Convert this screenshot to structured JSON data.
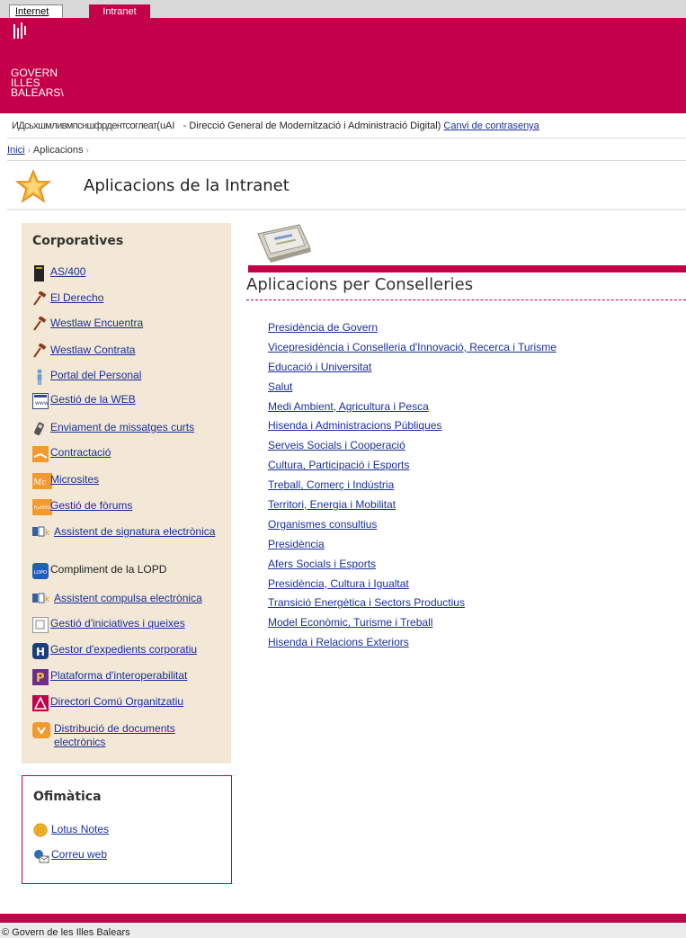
{
  "tabs": {
    "internet": "Internet",
    "intranet": "Intranet"
  },
  "header": {
    "logo_lines": [
      "GOVERN",
      "ILLES",
      "BALEARS\\"
    ]
  },
  "userbar": {
    "scribble": "ИДсьхшмливмпсншфрдентсоглеат",
    "text": "(uAI   - Direcció General de Modernització i Administració Digital)",
    "link": "Canvi de contrasenya"
  },
  "breadcrumb": {
    "home": "Inici",
    "current": "Aplicacions",
    "sep": "›"
  },
  "page_title": "Aplicacions de la Intranet",
  "sidebar": {
    "title": "Corporatives",
    "items": [
      {
        "label": "AS/400",
        "icon": "server-icon",
        "link": true
      },
      {
        "label": "El Derecho",
        "icon": "gavel-icon",
        "link": true
      },
      {
        "label": "Westlaw Encuentra",
        "icon": "gavel-icon",
        "link": true
      },
      {
        "label": "Westlaw Contrata",
        "icon": "gavel-icon",
        "link": true
      },
      {
        "label": "Portal del Personal",
        "icon": "person-icon",
        "link": true
      },
      {
        "label": "Gestió de la WEB",
        "icon": "web-icon",
        "link": true
      },
      {
        "label": "Enviament de missatges curts",
        "icon": "phone-icon",
        "link": true
      },
      {
        "label": "Contractació",
        "icon": "contract-icon",
        "link": true
      },
      {
        "label": "Microsites",
        "icon": "microsites-icon",
        "link": true
      },
      {
        "label": "Gestió de fòrums",
        "icon": "forums-icon",
        "link": true
      },
      {
        "label": "Assistent de signatura electrònica",
        "icon": "signature-icon",
        "link": true
      },
      {
        "label": "Compliment de la LOPD",
        "icon": "lopd-icon",
        "link": false
      },
      {
        "label": "Assistent compulsa electrònica",
        "icon": "signature-icon",
        "link": true
      },
      {
        "label": "Gestió d'iniciatives i queixes",
        "icon": "complaints-icon",
        "link": true
      },
      {
        "label": "Gestor d'expedients corporatiu",
        "icon": "files-icon",
        "link": true
      },
      {
        "label": "Plataforma d'interoperabilitat",
        "icon": "platform-icon",
        "link": true
      },
      {
        "label": "Directori Comú Organitzatiu",
        "icon": "directory-icon",
        "link": true
      },
      {
        "label": "Distribució de documents electrònics",
        "icon": "documents-icon",
        "link": true
      }
    ]
  },
  "office": {
    "title": "Ofimàtica",
    "items": [
      {
        "label": "Lotus Notes",
        "icon": "lotus-icon"
      },
      {
        "label": "Correu web",
        "icon": "webmail-icon"
      }
    ]
  },
  "section_title": "Aplicacions per Conselleries",
  "conselleries": [
    "Presidència de Govern",
    "Vicepresidència i Conselleria d'Innovació, Recerca i Turisme",
    "Educació i Universitat",
    "Salut",
    "Medi Ambient, Agricultura i Pesca",
    "Hisenda i Administracions Públiques",
    "Serveis Socials i Cooperació",
    "Cultura, Participació i Esports",
    "Treball, Comerç i Indústria",
    "Territori, Energia i Mobilitat",
    "Organismes consultius",
    "Presidència",
    "Afers Socials i Esports",
    "Presidència, Cultura i Igualtat",
    "Transició Energètica i Sectors Productius",
    "Model Econòmic, Turisme i Treball",
    "Hisenda i Relacions Exteriors"
  ],
  "footer": "© Govern de les Illes Balears",
  "colors": {
    "brand": "#c4004a",
    "sidebar_bg": "#f2e8d5",
    "link": "#1a2f9c"
  }
}
